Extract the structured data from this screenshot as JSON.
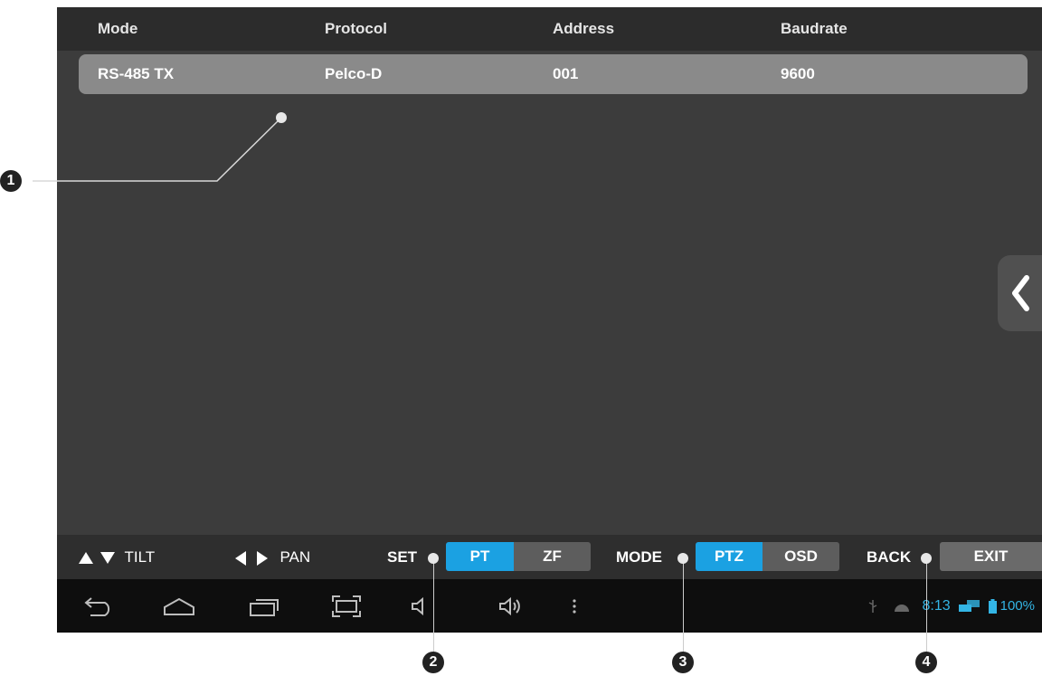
{
  "table": {
    "headers": [
      "Mode",
      "Protocol",
      "Address",
      "Baudrate"
    ],
    "row": [
      "RS-485 TX",
      "Pelco-D",
      "001",
      "9600"
    ]
  },
  "side_tab": {
    "icon": "chevron-left-icon"
  },
  "toolbar": {
    "tilt_label": "TILT",
    "pan_label": "PAN",
    "set_label": "SET",
    "set_options": [
      "PT",
      "ZF"
    ],
    "set_selected": "PT",
    "mode_label": "MODE",
    "mode_options": [
      "PTZ",
      "OSD"
    ],
    "mode_selected": "PTZ",
    "back_label": "BACK",
    "exit_label": "EXIT"
  },
  "navbar": {
    "icons": [
      "back-icon",
      "home-icon",
      "recent-apps-icon",
      "screenshot-icon",
      "volume-down-icon",
      "volume-up-icon",
      "menu-icon"
    ]
  },
  "status_bar": {
    "time": "8:13",
    "battery": "100%",
    "icons": [
      "usb-icon",
      "android-icon",
      "network-icon",
      "battery-icon"
    ]
  },
  "callouts": [
    "1",
    "2",
    "3",
    "4"
  ],
  "colors": {
    "accent": "#1ba1e2",
    "status_text": "#33b5e5"
  }
}
